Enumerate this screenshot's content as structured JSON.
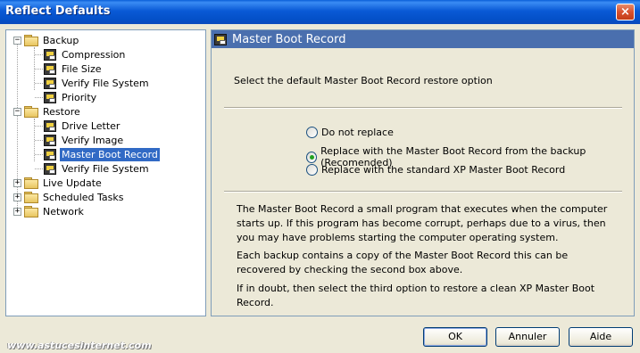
{
  "window": {
    "title": "Reflect Defaults",
    "close_glyph": "×"
  },
  "tree": {
    "backup": {
      "label": "Backup",
      "expander": "−"
    },
    "compression": "Compression",
    "file_size": "File Size",
    "verify_fs_backup": "Verify File System",
    "priority": "Priority",
    "restore": {
      "label": "Restore",
      "expander": "−"
    },
    "drive_letter": "Drive Letter",
    "verify_image": "Verify Image",
    "mbr": "Master Boot Record",
    "verify_fs_restore": "Verify File System",
    "live_update": {
      "label": "Live Update",
      "expander": "+"
    },
    "scheduled_tasks": {
      "label": "Scheduled Tasks",
      "expander": "+"
    },
    "network": {
      "label": "Network",
      "expander": "+"
    }
  },
  "panel": {
    "title": "Master Boot Record",
    "prompt": "Select the default Master Boot Record restore option",
    "options": [
      {
        "label": "Do not replace",
        "checked": false
      },
      {
        "label": "Replace with the Master Boot Record from the backup (Recomended)",
        "checked": true
      },
      {
        "label": "Replace with the standard XP Master Boot Record",
        "checked": false
      }
    ],
    "desc1": "The Master Boot Record a small program that executes when the computer starts up. If this program has become corrupt, perhaps due to a virus, then you may have problems starting the computer operating system.",
    "desc2": "Each backup contains a copy of the Master Boot Record this can be recovered by checking the second box above.",
    "desc3": "If in doubt, then select the third option to restore a clean XP Master Boot Record."
  },
  "buttons": {
    "ok": "OK",
    "cancel": "Annuler",
    "help": "Aide"
  },
  "watermark": "www.astucesinternet.com"
}
